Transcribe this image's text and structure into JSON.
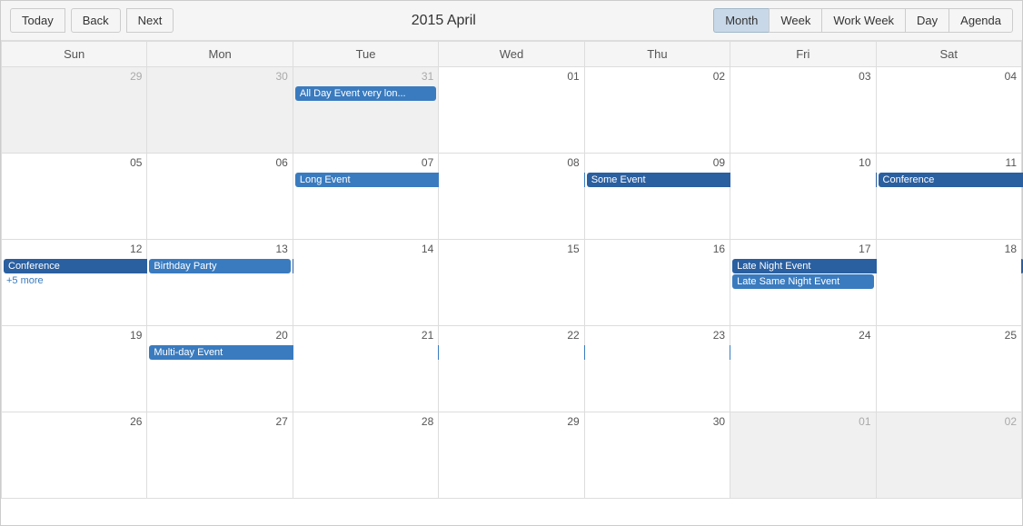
{
  "toolbar": {
    "today_label": "Today",
    "back_label": "Back",
    "next_label": "Next",
    "title": "2015 April",
    "views": [
      "Month",
      "Week",
      "Work Week",
      "Day",
      "Agenda"
    ],
    "active_view": "Month"
  },
  "calendar": {
    "headers": [
      "Sun",
      "Mon",
      "Tue",
      "Wed",
      "Thu",
      "Fri",
      "Sat"
    ],
    "weeks": [
      {
        "days": [
          {
            "date": "29",
            "other": true
          },
          {
            "date": "30",
            "other": true
          },
          {
            "date": "31",
            "other": true,
            "events": [
              {
                "label": "All Day Event very lon...",
                "color": "medium",
                "span": 1
              }
            ]
          },
          {
            "date": "01"
          },
          {
            "date": "02"
          },
          {
            "date": "03"
          },
          {
            "date": "04"
          }
        ]
      },
      {
        "days": [
          {
            "date": "05"
          },
          {
            "date": "06"
          },
          {
            "date": "07",
            "events": [
              {
                "label": "Long Event",
                "color": "medium",
                "span": 5
              }
            ]
          },
          {
            "date": "08"
          },
          {
            "date": "09",
            "events": [
              {
                "label": "Some Event",
                "color": "dark",
                "span": 2
              }
            ]
          },
          {
            "date": "10"
          },
          {
            "date": "11",
            "events": [
              {
                "label": "Conference",
                "color": "dark",
                "span": 2
              }
            ]
          }
        ]
      },
      {
        "days": [
          {
            "date": "12",
            "events": [
              {
                "label": "Conference",
                "color": "dark",
                "span": 2
              },
              {
                "label": "+5 more",
                "type": "more"
              }
            ]
          },
          {
            "date": "13",
            "events": [
              {
                "label": "Birthday Party",
                "color": "medium",
                "span": 1
              }
            ]
          },
          {
            "date": "14"
          },
          {
            "date": "15"
          },
          {
            "date": "16"
          },
          {
            "date": "17",
            "events": [
              {
                "label": "Late Night Event",
                "color": "dark",
                "span": 2
              },
              {
                "label": "Late Same Night Event",
                "color": "medium",
                "span": 1
              }
            ]
          },
          {
            "date": "18"
          }
        ]
      },
      {
        "days": [
          {
            "date": "19"
          },
          {
            "date": "20",
            "events": [
              {
                "label": "Multi-day Event",
                "color": "medium",
                "span": 4
              }
            ]
          },
          {
            "date": "21"
          },
          {
            "date": "22"
          },
          {
            "date": "23"
          },
          {
            "date": "24"
          },
          {
            "date": "25"
          }
        ]
      },
      {
        "days": [
          {
            "date": "26"
          },
          {
            "date": "27"
          },
          {
            "date": "28"
          },
          {
            "date": "29"
          },
          {
            "date": "30"
          },
          {
            "date": "01",
            "other": true
          },
          {
            "date": "02",
            "other": true
          }
        ]
      }
    ]
  }
}
